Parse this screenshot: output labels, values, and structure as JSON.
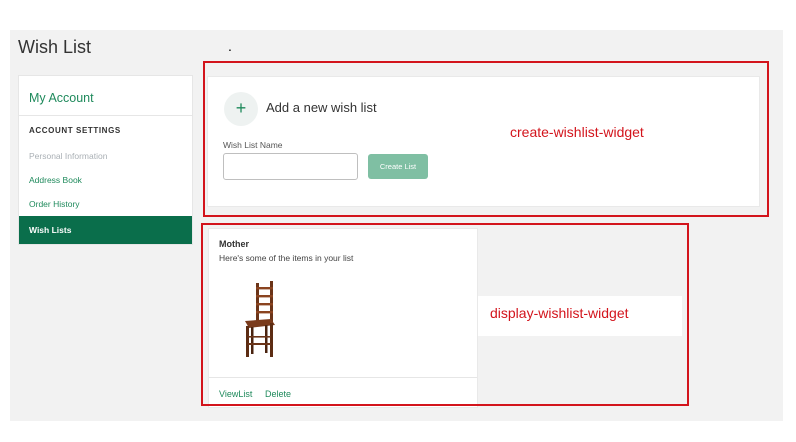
{
  "page": {
    "title": "Wish List",
    "stray_dot": "."
  },
  "sidebar": {
    "header": "My Account",
    "section_title": "ACCOUNT SETTINGS",
    "items": [
      {
        "label": "Personal Information",
        "state": "muted"
      },
      {
        "label": "Address Book",
        "state": "link"
      },
      {
        "label": "Order History",
        "state": "link"
      },
      {
        "label": "Wish Lists",
        "state": "active"
      }
    ]
  },
  "create_widget": {
    "plus_glyph": "+",
    "title": "Add a new wish list",
    "field_label": "Wish List Name",
    "input_value": "",
    "button_label": "Create List"
  },
  "display_widget": {
    "list_name": "Mother",
    "subtitle": "Here's some of the items in your list",
    "actions": {
      "view": "ViewList",
      "delete": "Delete"
    }
  },
  "annotations": {
    "create_label": "create-wishlist-widget",
    "display_label": "display-wishlist-widget"
  },
  "colors": {
    "brand_green": "#1f8a5c",
    "active_green": "#0a6e4b",
    "button_green": "#7fbfa3",
    "annotation_red": "#d3141c"
  }
}
